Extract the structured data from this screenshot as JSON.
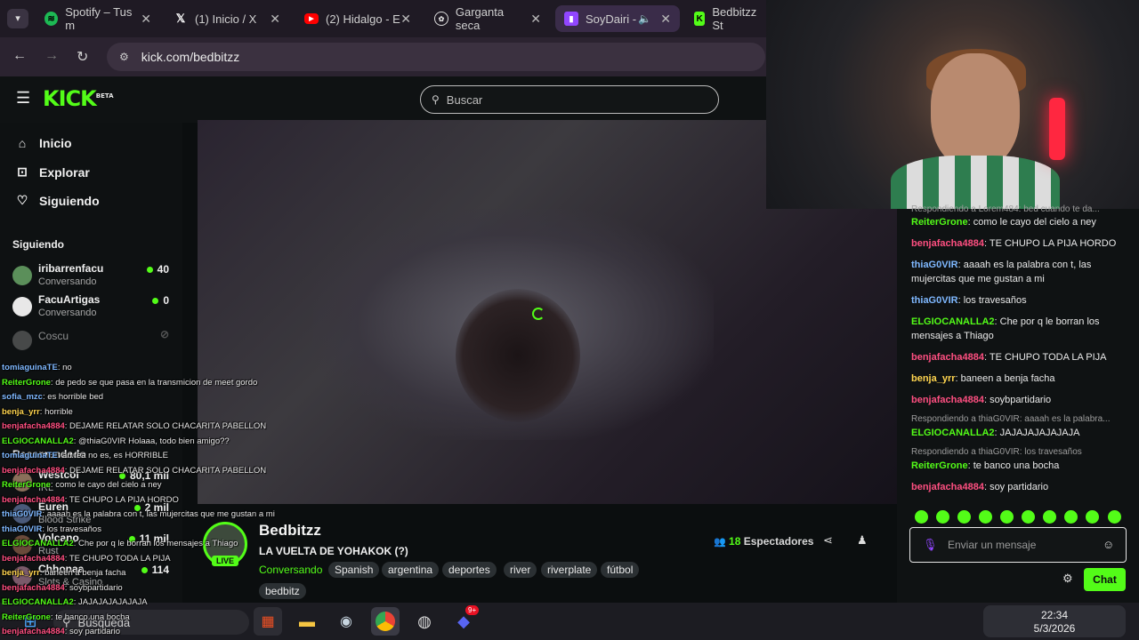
{
  "browser": {
    "tabs": [
      {
        "label": "Spotify – Tus m",
        "favicon": "spotify-icon",
        "color": "#1db954"
      },
      {
        "label": "(1) Inicio / X",
        "favicon": "x-icon",
        "color": "#ffffff"
      },
      {
        "label": "(2) Hidalgo - E",
        "favicon": "youtube-icon",
        "color": "#ff0000"
      },
      {
        "label": "Garganta seca",
        "favicon": "openai-icon",
        "color": "#ffffff"
      },
      {
        "label": "SoyDairi -",
        "favicon": "twitch-icon",
        "color": "#9146ff"
      },
      {
        "label": "Bedbitzz St",
        "favicon": "kick-icon",
        "color": "#53fc18"
      }
    ],
    "url": "kick.com/bedbitzz"
  },
  "kick": {
    "logo_text": "KICK",
    "logo_beta": "BETA",
    "search_placeholder": "Buscar",
    "nav": [
      {
        "label": "Inicio",
        "icon": "home-icon"
      },
      {
        "label": "Explorar",
        "icon": "compass-icon"
      },
      {
        "label": "Siguiendo",
        "icon": "heart-icon"
      }
    ],
    "following_title": "Siguiendo",
    "following": [
      {
        "name": "iribarrenfacu",
        "sub": "Conversando",
        "count": "40",
        "live": true,
        "color": "#5b8f5a"
      },
      {
        "name": "FacuArtigas",
        "sub": "Conversando",
        "count": "0",
        "live": true,
        "color": "#e8e8e8"
      },
      {
        "name": "Coscu",
        "sub": "",
        "count": "",
        "live": false,
        "color": "#777777"
      }
    ],
    "recommended_title": "Recomendado",
    "recommended": [
      {
        "name": "Westcol",
        "sub": "IRL",
        "count": "80,1 mil"
      },
      {
        "name": "Euren",
        "sub": "Blood Strike",
        "count": "2 mil"
      },
      {
        "name": "Volcano",
        "sub": "Rust",
        "count": "11 mil"
      },
      {
        "name": "Chhonaa",
        "sub": "Slots & Casino",
        "count": "114"
      }
    ]
  },
  "stream": {
    "channel": "Bedbitzz",
    "title": "LA VUELTA DE YOHAKOK (?)",
    "category": "Conversando",
    "tags": [
      "Spanish",
      "argentina",
      "deportes",
      "river",
      "riverplate",
      "fútbol",
      "bedbitz"
    ],
    "viewers_count": "18",
    "viewers_label": "Espectadores",
    "live_label": "LIVE"
  },
  "chat": {
    "messages": [
      {
        "type": "reply",
        "text": "Respondiendo a Lorem484: bed cuando te da..."
      },
      {
        "user": "ReiterGrone",
        "color": "#53fc18",
        "text": "como le cayo del cielo a ney"
      },
      {
        "user": "benjafacha4884",
        "color": "#ff4f81",
        "text": "TE CHUPO LA PIJA HORDO"
      },
      {
        "user": "thiaG0VIR",
        "color": "#7fb8ff",
        "text": "aaaah es la palabra con t, las mujercitas que me gustan a mi"
      },
      {
        "user": "thiaG0VIR",
        "color": "#7fb8ff",
        "text": "los travesaños"
      },
      {
        "user": "ELGIOCANALLA2",
        "color": "#53fc18",
        "text": "Che por q le borran los mensajes a Thiago"
      },
      {
        "user": "benjafacha4884",
        "color": "#ff4f81",
        "text": "TE CHUPO TODA LA PIJA"
      },
      {
        "user": "benja_yrr",
        "color": "#ffd54f",
        "text": "baneen a benja facha"
      },
      {
        "user": "benjafacha4884",
        "color": "#ff4f81",
        "text": "soybpartidario"
      },
      {
        "type": "reply",
        "text": "Respondiendo a thiaG0VIR: aaaah es la palabra..."
      },
      {
        "user": "ELGIOCANALLA2",
        "color": "#53fc18",
        "text": "JAJAJAJAJAJAJA"
      },
      {
        "type": "reply",
        "text": "Respondiendo a thiaG0VIR: los travesaños"
      },
      {
        "user": "ReiterGrone",
        "color": "#53fc18",
        "text": "te banco una bocha"
      },
      {
        "user": "benjafacha4884",
        "color": "#ff4f81",
        "text": "soy partidario"
      }
    ],
    "input_placeholder": "Enviar un mensaje",
    "send_label": "Chat"
  },
  "overlay": [
    {
      "user": "tomiaguinaTE",
      "text": "no"
    },
    {
      "user": "ReiterGrone",
      "text": "de pedo se que pasa en la transmicion de meet gordo"
    },
    {
      "user": "sofia_mzc",
      "text": "es horrible bed"
    },
    {
      "user": "benja_yrr",
      "text": "horrible"
    },
    {
      "user": "benjafacha4884",
      "text": "DEJAME RELATAR SOLO CHACARITA PABELLON"
    },
    {
      "user": "ELGIOCANALLA2",
      "text": "@thiaG0VIR Holaaa, todo bien amigo??"
    },
    {
      "user": "tomiaguinaTE",
      "text": "an fea no es, es HORRIBLE"
    },
    {
      "user": "benjafacha4884",
      "text": "DEJAME RELATAR SOLO CHACARITA PABELLON"
    },
    {
      "user": "ReiterGrone",
      "text": "como le cayo del cielo a ney"
    },
    {
      "user": "benjafacha4884",
      "text": "TE CHUPO LA PIJA HORDO"
    },
    {
      "user": "thiaG0VIR",
      "text": "aaaah es la palabra con t, las mujercitas que me gustan a mi"
    },
    {
      "user": "thiaG0VIR",
      "text": "los travesaños"
    },
    {
      "user": "ELGIOCANALLA2",
      "text": "Che por q le borran los mensajes a Thiago"
    },
    {
      "user": "benjafacha4884",
      "text": "TE CHUPO TODA LA PIJA"
    },
    {
      "user": "benja_yrr",
      "text": "baneen a benja facha"
    },
    {
      "user": "benjafacha4884",
      "text": "soybpartidario"
    },
    {
      "user": "ELGIOCANALLA2",
      "text": "JAJAJAJAJAJAJA"
    },
    {
      "user": "ReiterGrone",
      "text": "te banco una bocha"
    },
    {
      "user": "benjafacha4884",
      "text": "soy partidario"
    }
  ],
  "taskbar": {
    "search_label": "Búsqueda",
    "time": "22:34",
    "date": "5/3/2026",
    "discord_badge": "9+"
  }
}
